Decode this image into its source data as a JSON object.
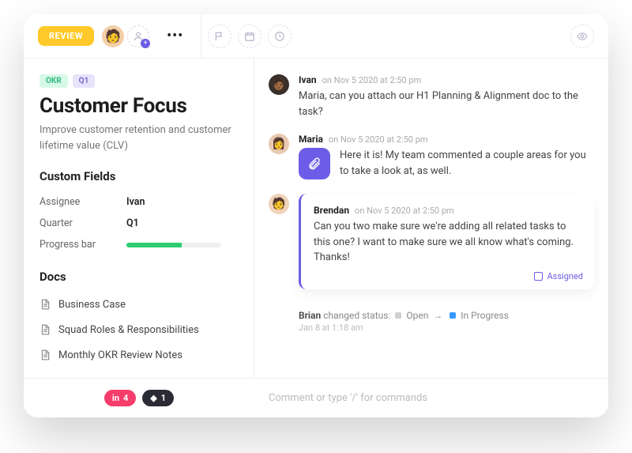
{
  "topbar": {
    "review_badge": "REVIEW"
  },
  "left": {
    "tags": {
      "okr": "OKR",
      "q1": "Q1"
    },
    "title": "Customer Focus",
    "subtitle": "Improve customer retention and customer lifetime value (CLV)",
    "custom_fields_heading": "Custom Fields",
    "fields": {
      "assignee_label": "Assignee",
      "assignee_value": "Ivan",
      "quarter_label": "Quarter",
      "quarter_value": "Q1",
      "progress_label": "Progress bar"
    },
    "docs_heading": "Docs",
    "docs": [
      {
        "label": "Business Case"
      },
      {
        "label": "Squad Roles & Responsibilities"
      },
      {
        "label": "Monthly OKR Review Notes"
      }
    ]
  },
  "activity": {
    "comments": [
      {
        "author": "Ivan",
        "meta": "on Nov 5 2020 at 2:50 pm",
        "text": "Maria, can you attach our H1 Planning & Alignment doc to the task?"
      },
      {
        "author": "Maria",
        "meta": "on Nov 5 2020 at 2:50 pm",
        "text": "Here it is! My team commented a couple areas for you to take a look at, as well."
      },
      {
        "author": "Brendan",
        "meta": "on Nov 5 2020 at 2:50 pm",
        "text": "Can you two make sure we're adding all related tasks to this one? I want to make sure we all know what's coming. Thanks!",
        "assigned_label": "Assigned"
      }
    ],
    "status": {
      "actor": "Brian",
      "verb": "changed status:",
      "from": "Open",
      "to": "In Progress",
      "time": "Jan 8 at 1:18 am"
    }
  },
  "footer": {
    "pill_linkedin_count": "4",
    "pill_figma_count": "1",
    "input_placeholder": "Comment or type '/' for commands"
  }
}
